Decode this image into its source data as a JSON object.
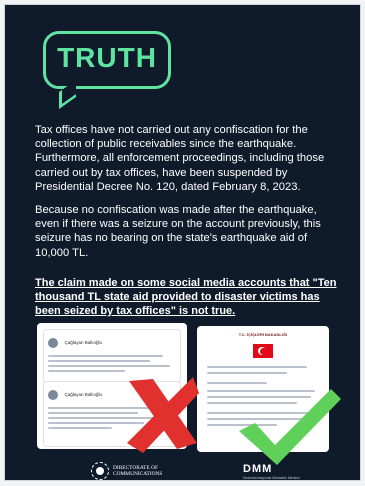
{
  "card": {
    "badge": "TRUTH",
    "paragraph1": "Tax offices have not carried out any confiscation for the collection of public receivables since the earthquake. Furthermore, all enforcement proceedings, including those carried out by tax offices, have been suspended by Presidential Decree No. 120, dated February 8, 2023.",
    "paragraph2": "Because no confiscation was made after the earthquake, even if there was a seizure on the account previously, this seizure has no bearing on the state's earthquake aid of 10,000 TL.",
    "claim": "The claim made on some social media accounts that \"Ten thousand TL state aid provided to disaster victims has been seized by tax offices\" is not true."
  },
  "evidence": {
    "false_post_author": "Çağlayan Ballıoğlu",
    "document_title": "T.C. İÇİŞLERİ BAKANLIĞI"
  },
  "footer": {
    "left_org_line1": "DIRECTORATE OF",
    "left_org_line2": "COMMUNICATIONS",
    "right_logo": "DMM",
    "right_subtitle": "Dezenformasyonla Mücadele Merkezi"
  },
  "colors": {
    "background": "#0f1a2b",
    "accent": "#5ee3a1",
    "false_mark": "#e0312f",
    "true_mark": "#5fd15a"
  },
  "icons": {
    "false_mark": "cross-icon",
    "true_mark": "check-icon"
  }
}
